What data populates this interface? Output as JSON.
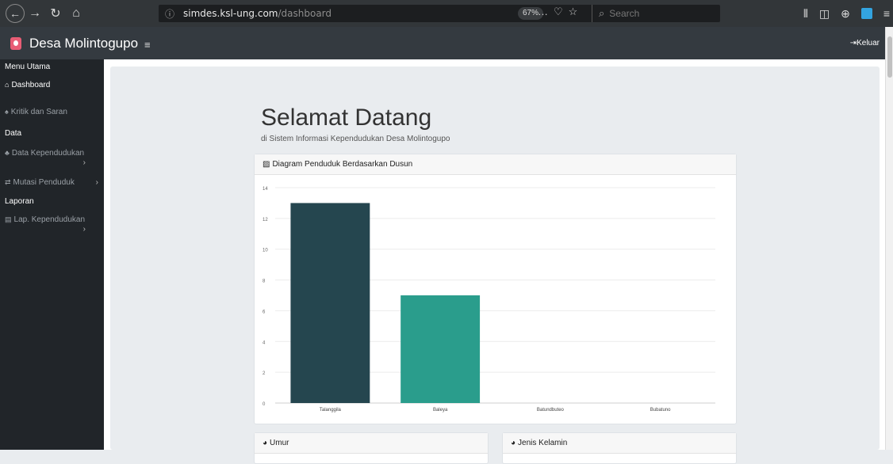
{
  "browser": {
    "back_icon": "arrow-left-icon",
    "url_host": "simdes.ksl-ung.com",
    "url_path": "/dashboard",
    "zoom": "67%",
    "search_placeholder": "Search"
  },
  "app": {
    "brand": "Desa Molintogupo",
    "logout": "Keluar"
  },
  "sidebar": {
    "sections": [
      {
        "heading": "Menu Utama",
        "items": [
          {
            "label": "Dashboard",
            "icon": "home-icon",
            "active": true
          },
          {
            "label": "Kritik dan Saran",
            "icon": "bell-icon"
          }
        ]
      },
      {
        "heading": "Data",
        "items": [
          {
            "label": "Data Kependudukan",
            "icon": "users-icon",
            "chevron": true
          },
          {
            "label": "Mutasi Penduduk",
            "icon": "exchange-icon",
            "chevron": true
          }
        ]
      },
      {
        "heading": "Laporan",
        "items": [
          {
            "label": "Lap. Kependudukan",
            "icon": "print-icon",
            "chevron": true
          }
        ]
      }
    ]
  },
  "main": {
    "title": "Selamat Datang",
    "subtitle": "di Sistem Informasi Kependudukan Desa Molintogupo",
    "chart_card_title": "Diagram Penduduk Berdasarkan Dusun",
    "umur_title": "Umur",
    "gender_title": "Jenis Kelamin"
  },
  "chart_data": {
    "type": "bar",
    "categories": [
      "Talanggila",
      "Baleya",
      "Batundbuteo",
      "Bubatuno"
    ],
    "values": [
      13,
      7,
      0,
      0
    ],
    "colors": [
      "#25464f",
      "#2a9d8c",
      "#2a9d8c",
      "#2a9d8c"
    ],
    "ylim": [
      0,
      14
    ],
    "yticks": [
      0,
      2,
      4,
      6,
      8,
      10,
      12,
      14
    ],
    "grid": true,
    "title": "",
    "xlabel": "",
    "ylabel": ""
  }
}
